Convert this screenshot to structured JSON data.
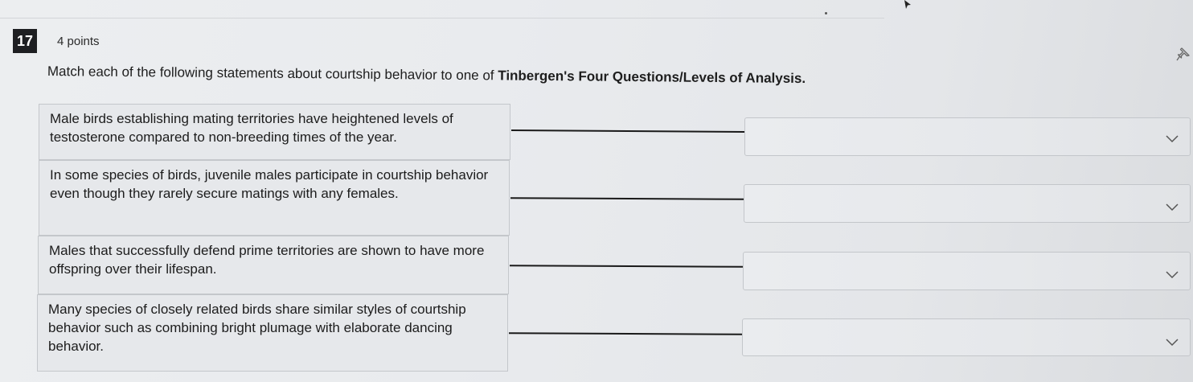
{
  "question": {
    "number": "17",
    "points": "4 points",
    "prompt_plain": "Match each of the following statements about courtship behavior to one of ",
    "prompt_bold": "Tinbergen's Four Questions/Levels of Analysis."
  },
  "items": [
    {
      "statement": "Male birds establishing mating territories have heightened levels of testosterone compared to non-breeding times of the year.",
      "selected": ""
    },
    {
      "statement": "In some species of birds, juvenile males participate in courtship behavior even though they rarely secure matings with any females.",
      "selected": ""
    },
    {
      "statement": "Males that successfully defend prime territories are shown to have more offspring over their lifespan.",
      "selected": ""
    },
    {
      "statement": "Many species of closely related birds share similar styles of courtship behavior such as combining bright plumage with elaborate dancing behavior.",
      "selected": ""
    }
  ],
  "icons": {
    "pin": "pin-icon",
    "caret": "chevron-down-icon",
    "cursor": "cursor-icon"
  },
  "colors": {
    "badge": "#1e1f22",
    "connector": "#1a1a1a"
  }
}
